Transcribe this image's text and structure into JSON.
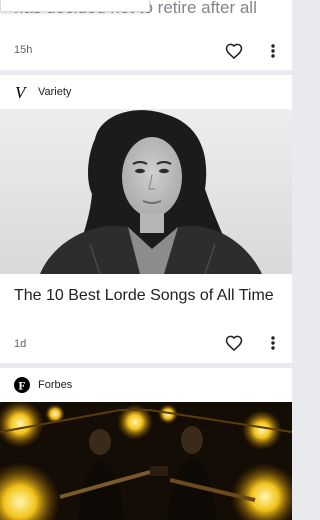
{
  "card1": {
    "headline_fragment": "has decided not to retire after all",
    "time": "15h"
  },
  "card2": {
    "source": "Variety",
    "source_logo_letter": "V",
    "headline": "The 10 Best Lorde Songs of All Time",
    "time": "1d"
  },
  "card3": {
    "source": "Forbes",
    "source_logo_letter": "F"
  },
  "icons": {
    "like": "heart-outline-icon",
    "more": "more-vert-icon"
  },
  "colors": {
    "background": "#e8eaed",
    "card": "#ffffff",
    "text": "#202124",
    "secondary": "#5f6368"
  }
}
